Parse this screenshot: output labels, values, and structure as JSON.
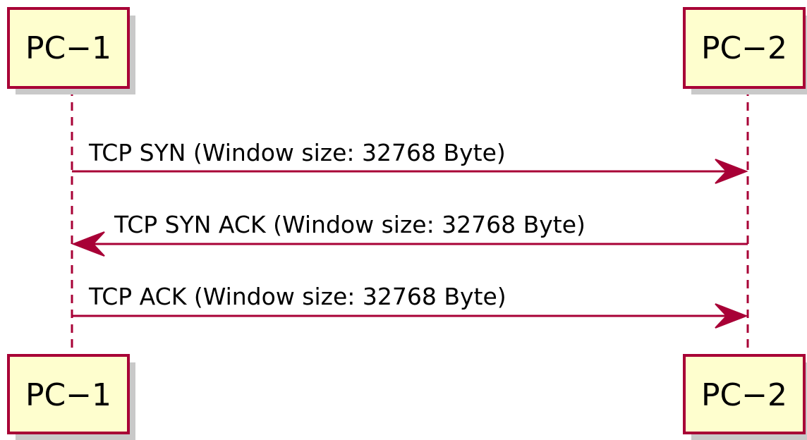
{
  "participants": {
    "left": {
      "label": "PC−1"
    },
    "right": {
      "label": "PC−2"
    }
  },
  "messages": [
    {
      "from": "PC−1",
      "to": "PC−2",
      "label": "TCP SYN (Window size: 32768 Byte)"
    },
    {
      "from": "PC−2",
      "to": "PC−1",
      "label": "TCP SYN ACK (Window size: 32768 Byte)"
    },
    {
      "from": "PC−1",
      "to": "PC−2",
      "label": "TCP ACK (Window size: 32768 Byte)"
    }
  ],
  "colors": {
    "participant_fill": "#FEFECE",
    "line": "#A80036"
  }
}
